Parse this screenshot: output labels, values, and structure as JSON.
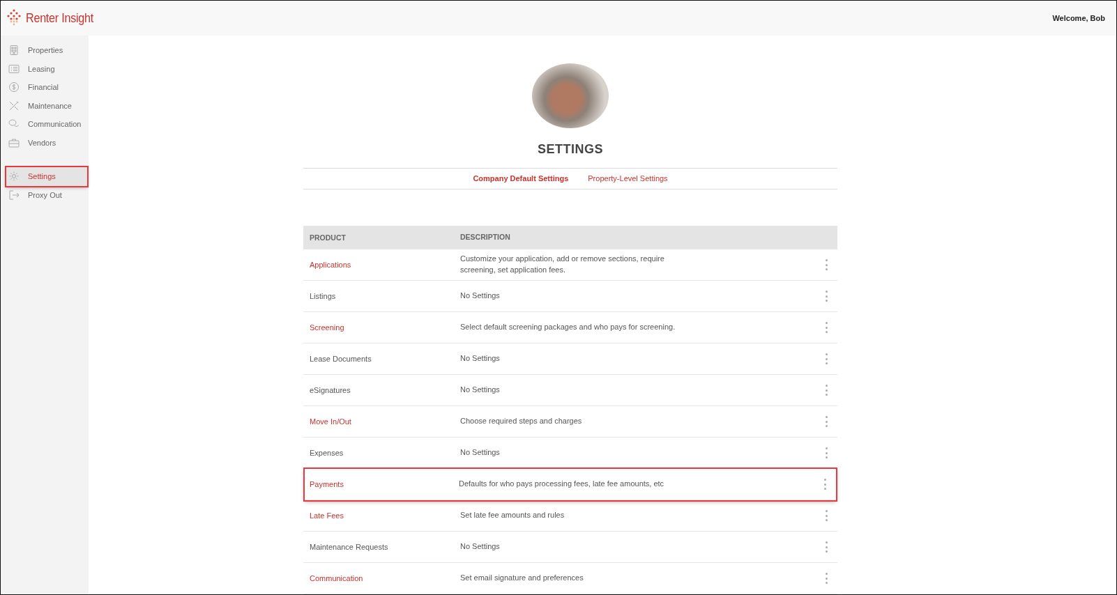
{
  "header": {
    "logo_text": "Renter Insight",
    "welcome": "Welcome, Bob"
  },
  "sidebar": {
    "groups": [
      {
        "items": [
          {
            "label": "Properties",
            "selected": false,
            "highlighted": false
          },
          {
            "label": "Leasing",
            "selected": false,
            "highlighted": false
          },
          {
            "label": "Financial",
            "selected": false,
            "highlighted": false
          },
          {
            "label": "Maintenance",
            "selected": false,
            "highlighted": false
          },
          {
            "label": "Communication",
            "selected": false,
            "highlighted": false
          },
          {
            "label": "Vendors",
            "selected": false,
            "highlighted": false
          }
        ]
      },
      {
        "items": [
          {
            "label": "Settings",
            "selected": true,
            "highlighted": true
          },
          {
            "label": "Proxy Out",
            "selected": false,
            "highlighted": false
          }
        ]
      }
    ]
  },
  "page": {
    "title": "SETTINGS",
    "tabs": [
      {
        "label": "Company Default Settings",
        "selected": true
      },
      {
        "label": "Property-Level Settings",
        "selected": false
      }
    ],
    "table": {
      "columns": [
        "PRODUCT",
        "DESCRIPTION"
      ],
      "rows": [
        {
          "product": "Applications",
          "description": "Customize your application, add or remove sections, require screening, set application fees.",
          "linked": true,
          "highlighted": false
        },
        {
          "product": "Listings",
          "description": "No Settings",
          "linked": false,
          "highlighted": false
        },
        {
          "product": "Screening",
          "description": "Select default screening packages and who pays for screening.",
          "linked": true,
          "highlighted": false
        },
        {
          "product": "Lease Documents",
          "description": "No Settings",
          "linked": false,
          "highlighted": false
        },
        {
          "product": "eSignatures",
          "description": "No Settings",
          "linked": false,
          "highlighted": false
        },
        {
          "product": "Move In/Out",
          "description": "Choose required steps and charges",
          "linked": true,
          "highlighted": false
        },
        {
          "product": "Expenses",
          "description": "No Settings",
          "linked": false,
          "highlighted": false
        },
        {
          "product": "Payments",
          "description": "Defaults for who pays processing fees, late fee amounts, etc",
          "linked": true,
          "highlighted": true
        },
        {
          "product": "Late Fees",
          "description": "Set late fee amounts and rules",
          "linked": true,
          "highlighted": false
        },
        {
          "product": "Maintenance Requests",
          "description": "No Settings",
          "linked": false,
          "highlighted": false
        },
        {
          "product": "Communication",
          "description": "Set email signature and preferences",
          "linked": true,
          "highlighted": false
        }
      ]
    }
  }
}
